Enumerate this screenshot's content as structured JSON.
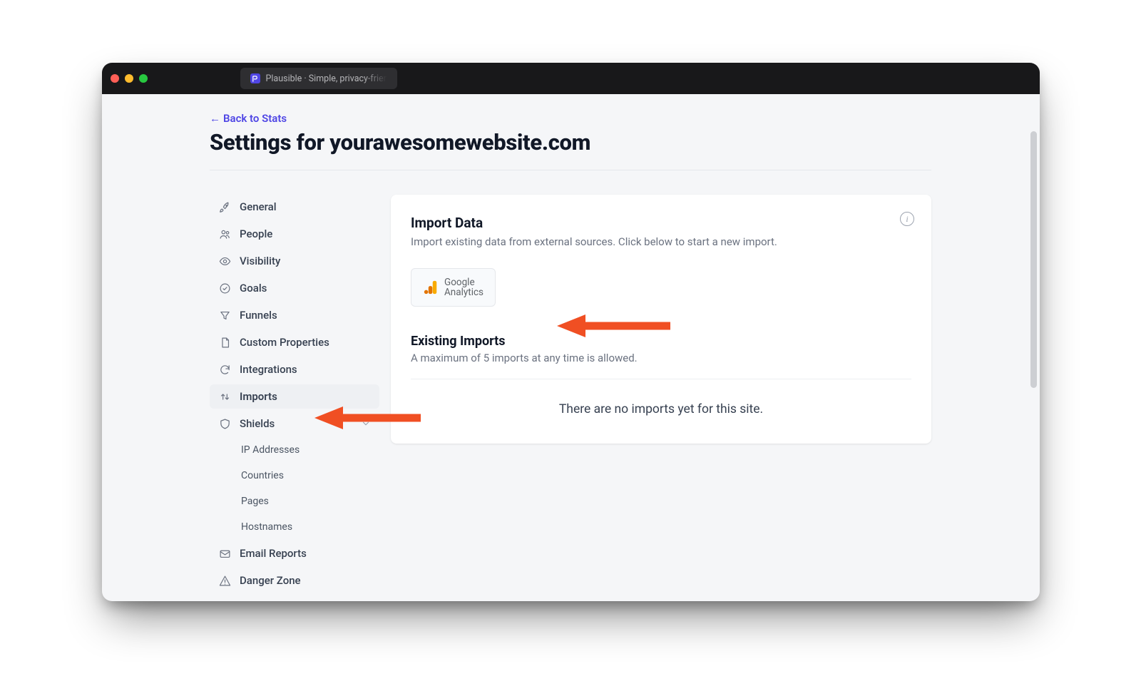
{
  "browser": {
    "tab_title": "Plausible · Simple, privacy-frien"
  },
  "header": {
    "back_label": "Back to Stats",
    "title": "Settings for yourawesomewebsite.com"
  },
  "sidebar": {
    "items": [
      {
        "id": "general",
        "label": "General",
        "icon": "rocket-icon"
      },
      {
        "id": "people",
        "label": "People",
        "icon": "people-icon"
      },
      {
        "id": "visibility",
        "label": "Visibility",
        "icon": "eye-icon"
      },
      {
        "id": "goals",
        "label": "Goals",
        "icon": "check-circle-icon"
      },
      {
        "id": "funnels",
        "label": "Funnels",
        "icon": "funnel-icon"
      },
      {
        "id": "custom-properties",
        "label": "Custom Properties",
        "icon": "document-icon"
      },
      {
        "id": "integrations",
        "label": "Integrations",
        "icon": "refresh-icon"
      },
      {
        "id": "imports",
        "label": "Imports",
        "icon": "arrows-updown-icon",
        "active": true
      },
      {
        "id": "shields",
        "label": "Shields",
        "icon": "shield-icon",
        "expandable": true
      }
    ],
    "shields_children": [
      {
        "id": "ip-addresses",
        "label": "IP Addresses"
      },
      {
        "id": "countries",
        "label": "Countries"
      },
      {
        "id": "pages",
        "label": "Pages"
      },
      {
        "id": "hostnames",
        "label": "Hostnames"
      }
    ],
    "rest": [
      {
        "id": "email-reports",
        "label": "Email Reports",
        "icon": "mail-icon"
      },
      {
        "id": "danger-zone",
        "label": "Danger Zone",
        "icon": "warning-icon"
      }
    ]
  },
  "main": {
    "import_title": "Import Data",
    "import_desc": "Import existing data from external sources. Click below to start a new import.",
    "ga_line1": "Google",
    "ga_line2": "Analytics",
    "existing_title": "Existing Imports",
    "existing_desc": "A maximum of 5 imports at any time is allowed.",
    "empty_msg": "There are no imports yet for this site."
  },
  "colors": {
    "accent": "#4f46e5",
    "arrow": "#f04f23"
  }
}
